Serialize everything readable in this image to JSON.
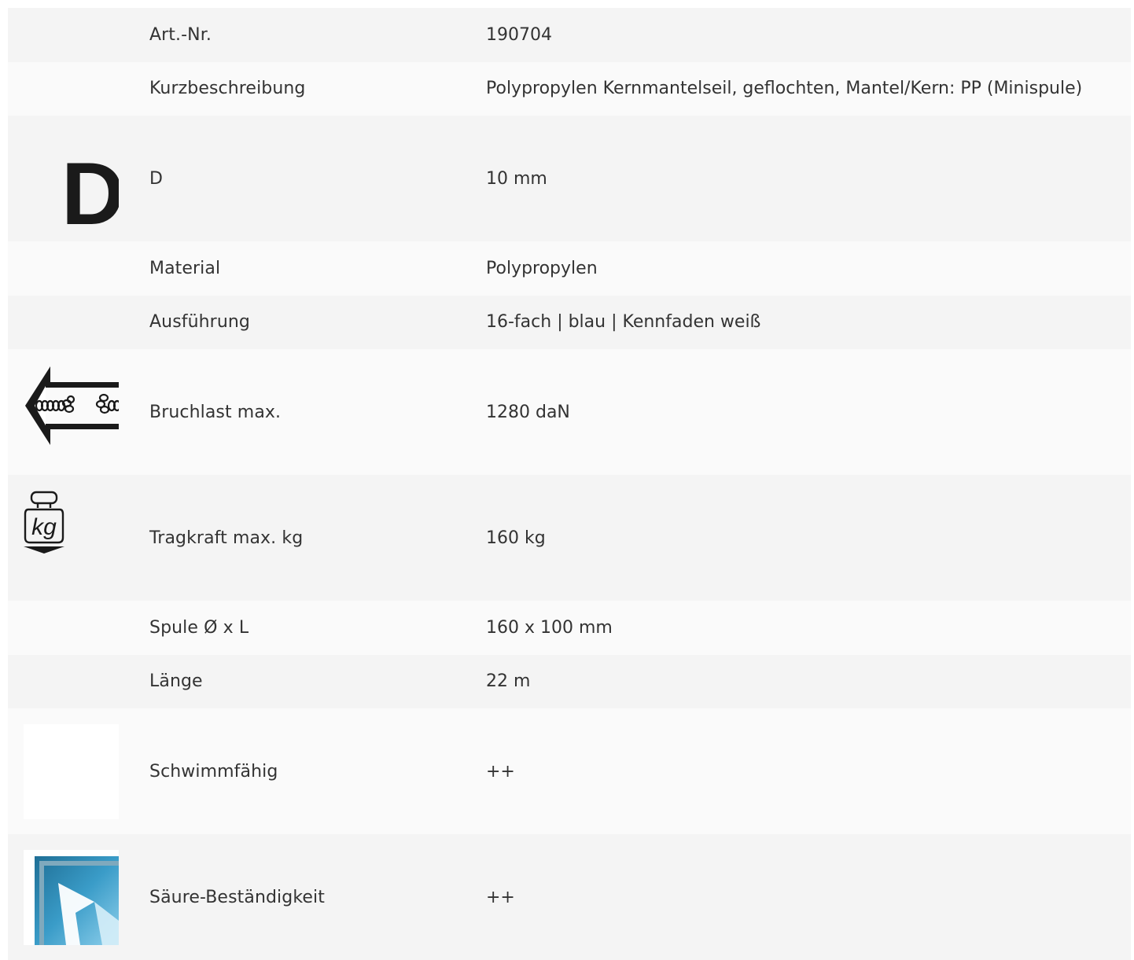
{
  "rows": [
    {
      "label": "Art.-Nr.",
      "value": "190704"
    },
    {
      "label": "Kurzbeschreibung",
      "value": "Polypropylen Kernmantelseil, geflochten, Mantel/Kern: PP (Minispule)"
    },
    {
      "label": "D",
      "value": "10 mm",
      "icon": "diameter-d-icon",
      "icon_text": "D"
    },
    {
      "label": "Material",
      "value": "Polypropylen"
    },
    {
      "label": "Ausführung",
      "value": "16-fach | blau | Kennfaden weiß"
    },
    {
      "label": "Bruchlast max.",
      "value": "1280 daN",
      "icon": "breaking-load-rope-arrow-icon"
    },
    {
      "label": "Tragkraft max. kg",
      "value": "160 kg",
      "icon": "weight-kg-icon",
      "icon_text": "kg"
    },
    {
      "label": "Spule Ø x L",
      "value": "160 x 100 mm"
    },
    {
      "label": "Länge",
      "value": "22 m"
    },
    {
      "label": "Schwimmfähig",
      "value": "++",
      "icon": "floatability-icon"
    },
    {
      "label": "Säure-Beständigkeit",
      "value": "++",
      "icon": "acid-resistance-icon"
    }
  ],
  "colors": {
    "row_odd": "#f4f4f4",
    "row_even": "#fafafa",
    "text": "#333333",
    "icon_dark": "#1a1a1a",
    "acid_blue": "#3a9cc8"
  }
}
